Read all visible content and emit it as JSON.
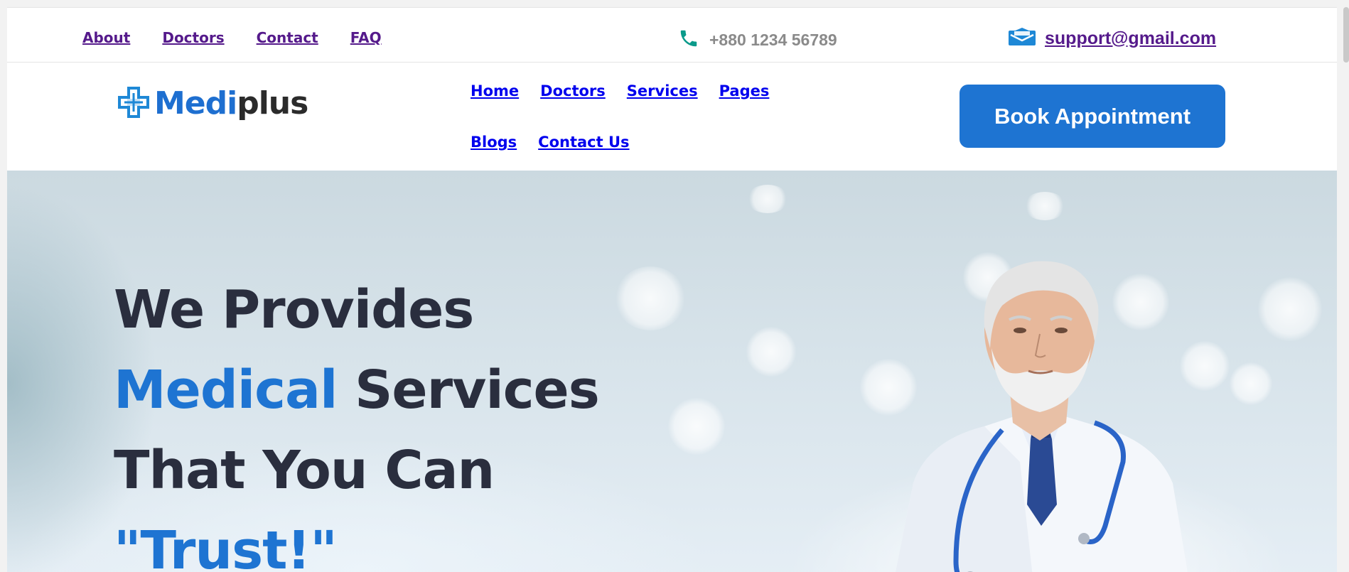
{
  "topbar": {
    "links": [
      {
        "label": "About"
      },
      {
        "label": "Doctors"
      },
      {
        "label": "Contact"
      },
      {
        "label": "FAQ"
      }
    ],
    "phone": "+880 1234 56789",
    "email": "support@gmail.com"
  },
  "header": {
    "logo": {
      "part1": "Medi",
      "part2": "plus"
    },
    "nav": [
      {
        "label": "Home"
      },
      {
        "label": "Doctors"
      },
      {
        "label": "Services"
      },
      {
        "label": "Pages"
      },
      {
        "label": "Blogs"
      },
      {
        "label": "Contact Us"
      }
    ],
    "cta": "Book Appointment"
  },
  "hero": {
    "line1": "We Provides",
    "line2_accent": "Medical",
    "line2_rest": " Services",
    "line3": "That You Can",
    "line4_accent": "\"Trust!\""
  },
  "colors": {
    "brand_blue": "#1e74d2",
    "heading_dark": "#2a2e3e",
    "phone_icon": "#0a9a8a",
    "email_icon": "#1e88d6"
  },
  "icons": {
    "phone": "phone-icon",
    "email": "envelope-icon",
    "logo": "medical-cross-icon"
  }
}
